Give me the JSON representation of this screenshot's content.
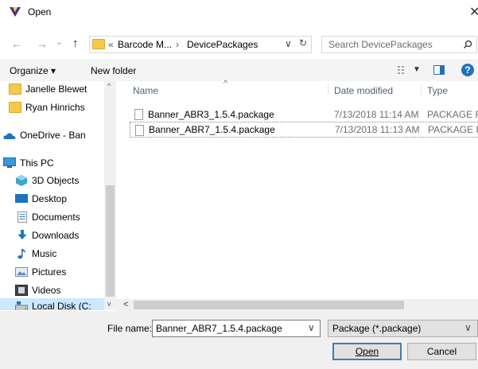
{
  "window": {
    "title": "Open",
    "close_glyph": "✕"
  },
  "nav": {
    "back": "←",
    "forward": "→",
    "dropdown": "⌄",
    "up": "↑"
  },
  "address": {
    "segments": [
      "«",
      "Barcode M...",
      "›",
      "DevicePackages"
    ],
    "dropdown": "∨",
    "refresh": "↻"
  },
  "search": {
    "placeholder": "Search DevicePackages",
    "icon": "search-icon"
  },
  "toolbar": {
    "organize": "Organize ▾",
    "new_folder": "New folder",
    "help": "?"
  },
  "sidebar": {
    "items": [
      {
        "label": "Janelle Blewet",
        "icon": "folder-icon"
      },
      {
        "label": "Ryan Hinrichs",
        "icon": "folder-icon"
      },
      {
        "label": "OneDrive - Ban",
        "icon": "cloud-icon"
      },
      {
        "label": "This PC",
        "icon": "computer-icon"
      },
      {
        "label": "3D Objects",
        "icon": "cube-icon"
      },
      {
        "label": "Desktop",
        "icon": "desktop-icon"
      },
      {
        "label": "Documents",
        "icon": "documents-icon"
      },
      {
        "label": "Downloads",
        "icon": "download-icon"
      },
      {
        "label": "Music",
        "icon": "music-icon"
      },
      {
        "label": "Pictures",
        "icon": "pictures-icon"
      },
      {
        "label": "Videos",
        "icon": "videos-icon"
      },
      {
        "label": "Local Disk (C:",
        "icon": "disk-icon"
      }
    ]
  },
  "columns": {
    "name": "Name",
    "date": "Date modified",
    "type": "Type",
    "sort_glyph": "^"
  },
  "files": [
    {
      "name": "Banner_ABR3_1.5.4.package",
      "date": "7/13/2018 11:14 AM",
      "type": "PACKAGE File"
    },
    {
      "name": "Banner_ABR7_1.5.4.package",
      "date": "7/13/2018 11:13 AM",
      "type": "PACKAGE File"
    }
  ],
  "bottom": {
    "filename_label": "File name:",
    "filename_value": "Banner_ABR7_1.5.4.package",
    "filetype_value": "Package (*.package)",
    "open_label": "Open",
    "cancel_label": "Cancel"
  },
  "colors": {
    "accent": "#1e73be",
    "selection_border": "#888888",
    "folder": "#f5c94a"
  }
}
